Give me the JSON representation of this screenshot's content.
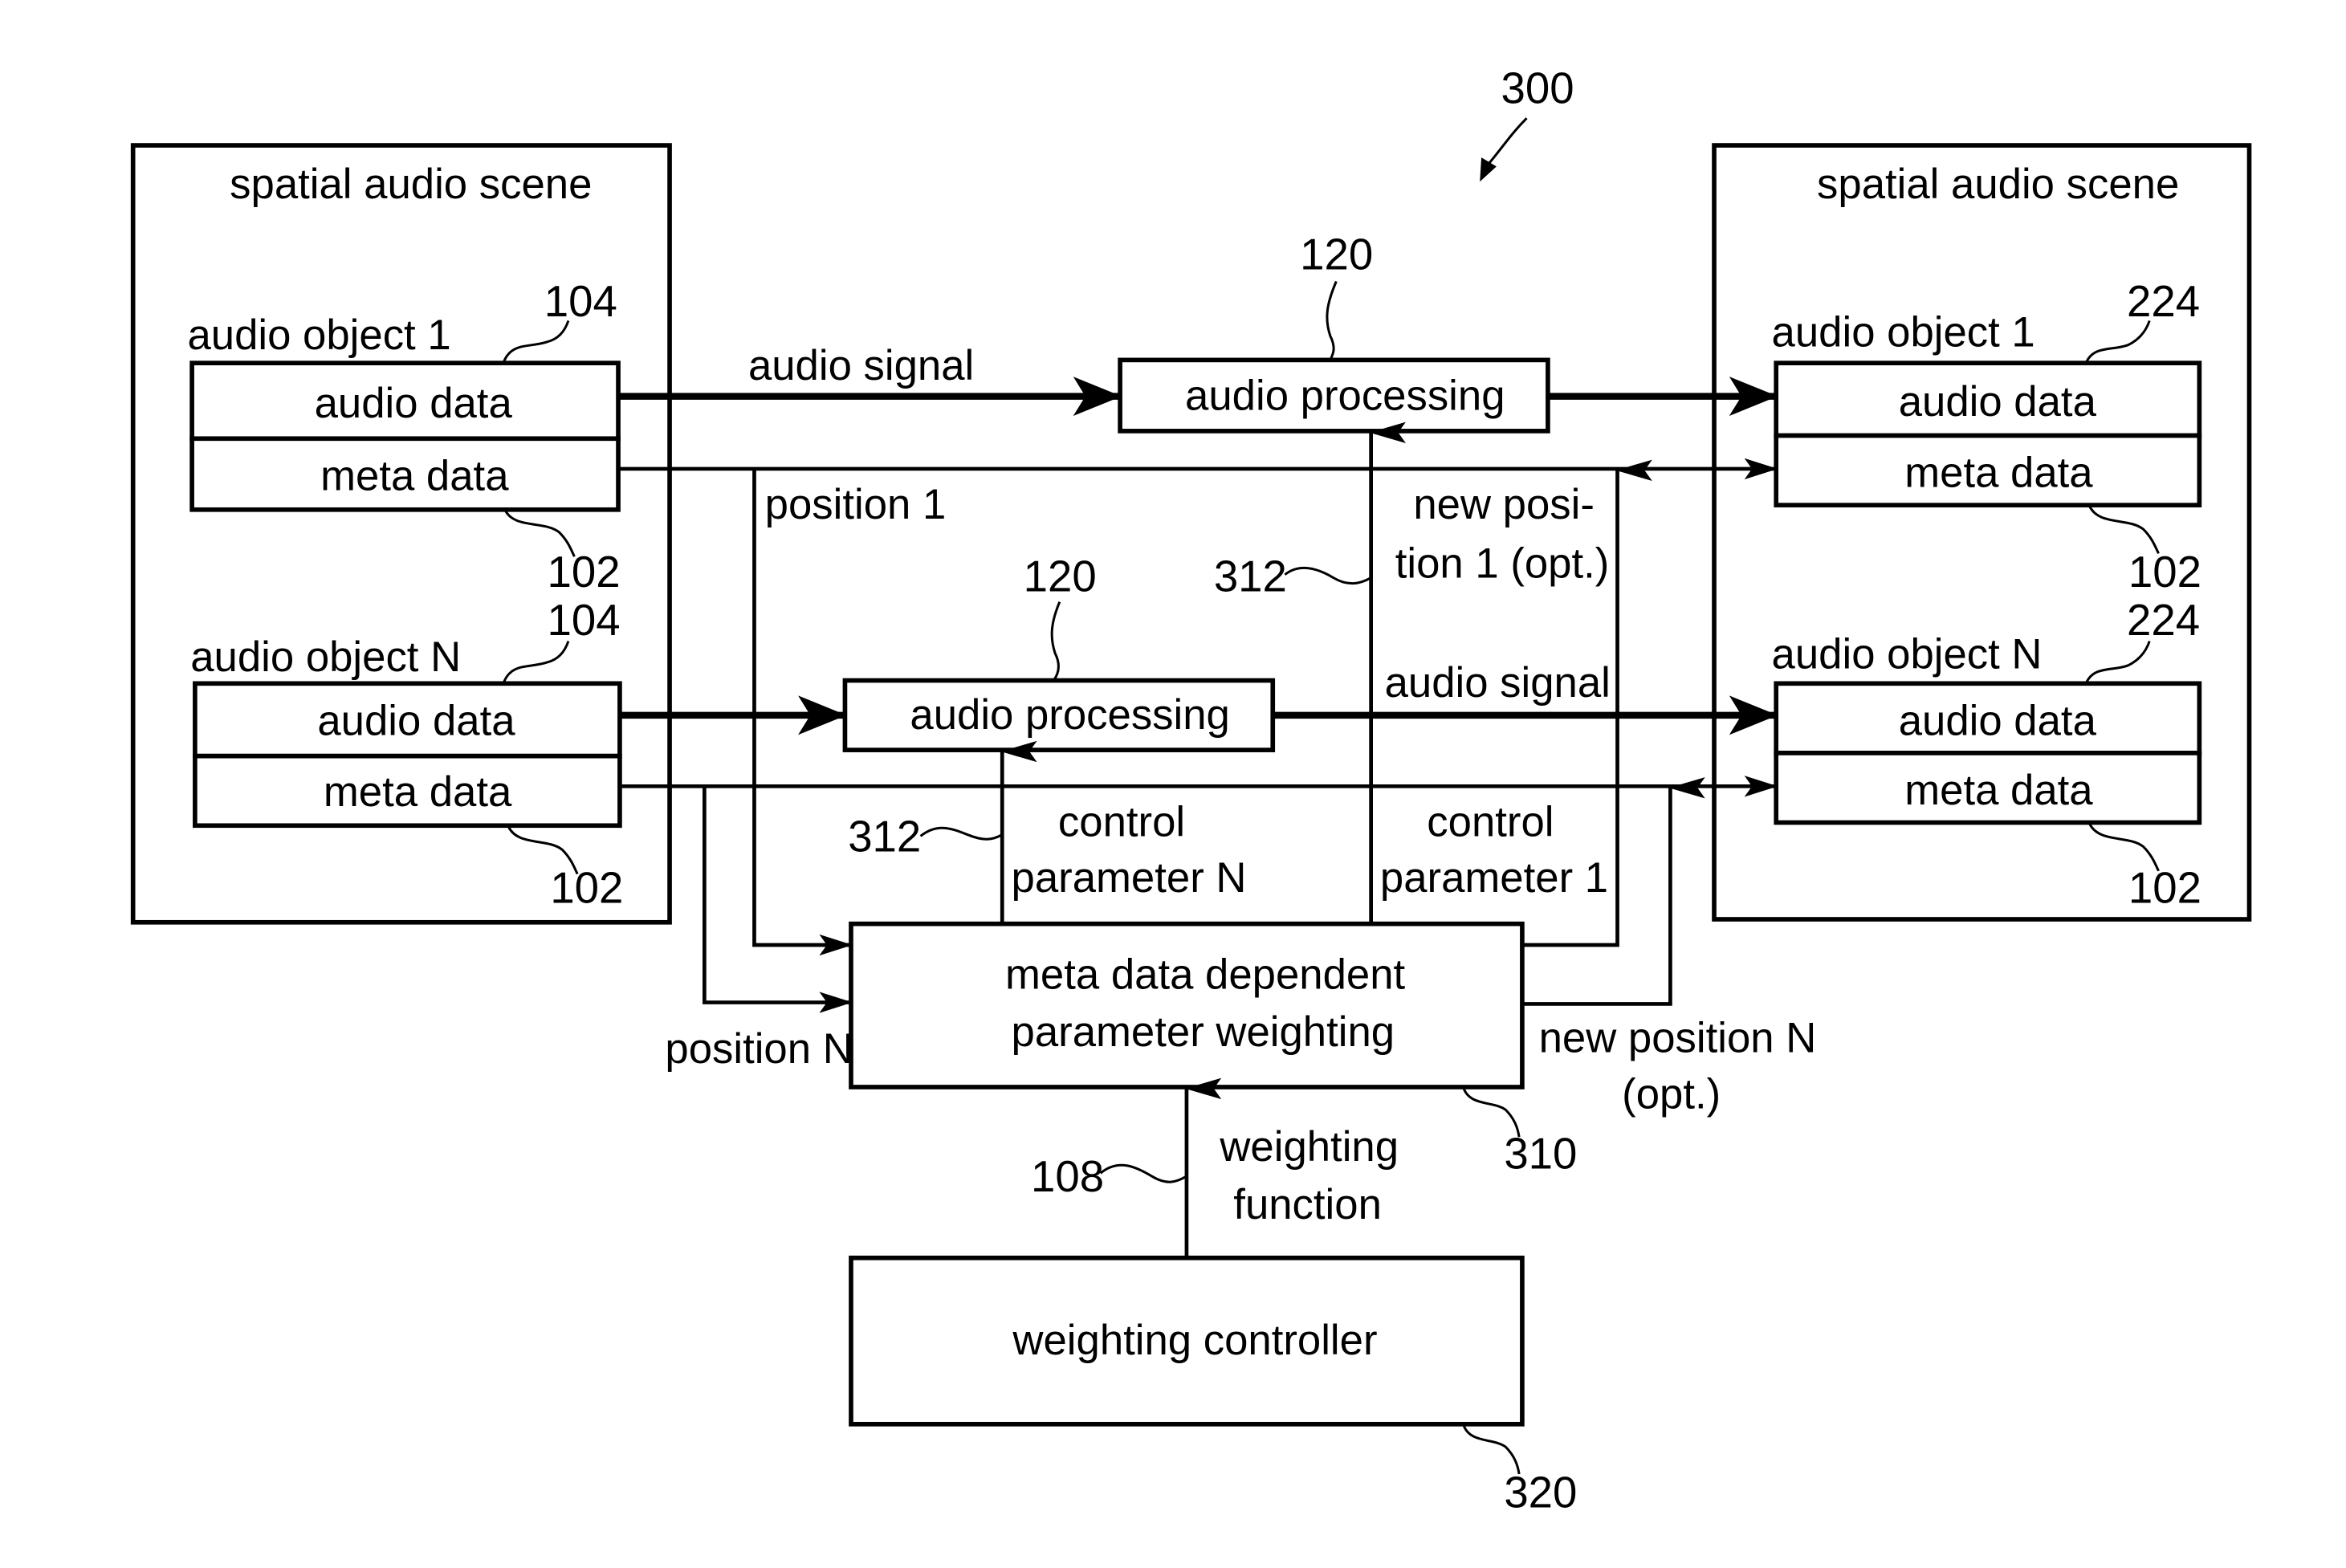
{
  "figure_ref": "300",
  "left_scene": {
    "title": "spatial audio scene",
    "objects": [
      {
        "label": "audio object 1",
        "ref_top": "104",
        "ref_bottom": "102",
        "audio": "audio data",
        "meta": "meta data"
      },
      {
        "label": "audio object N",
        "ref_top": "104",
        "ref_bottom": "102",
        "audio": "audio data",
        "meta": "meta data"
      }
    ]
  },
  "right_scene": {
    "title": "spatial audio scene",
    "objects": [
      {
        "label": "audio object 1",
        "ref_top": "224",
        "ref_bottom": "102",
        "audio": "audio data",
        "meta": "meta data"
      },
      {
        "label": "audio object N",
        "ref_top": "224",
        "ref_bottom": "102",
        "audio": "audio data",
        "meta": "meta data"
      }
    ]
  },
  "processing": [
    {
      "label": "audio processing",
      "ref": "120"
    },
    {
      "label": "audio processing",
      "ref": "120"
    }
  ],
  "weighting_block": {
    "line1": "meta data dependent",
    "line2": "parameter weighting",
    "ref": "310"
  },
  "controller": {
    "label": "weighting controller",
    "ref": "320"
  },
  "signals": {
    "audio_signal_1": "audio signal",
    "audio_signal_n": "audio signal",
    "position_1": "position 1",
    "position_n": "position N",
    "new_position_1_a": "new posi-",
    "new_position_1_b": "tion 1 (opt.)",
    "new_position_n_a": "new position N",
    "new_position_n_b": "(opt.)",
    "control_n_a": "control",
    "control_n_b": "parameter N",
    "control_1_a": "control",
    "control_1_b": "parameter 1",
    "weighting_fn_a": "weighting",
    "weighting_fn_b": "function",
    "ref_312_upper": "312",
    "ref_312_lower": "312",
    "ref_108": "108"
  }
}
